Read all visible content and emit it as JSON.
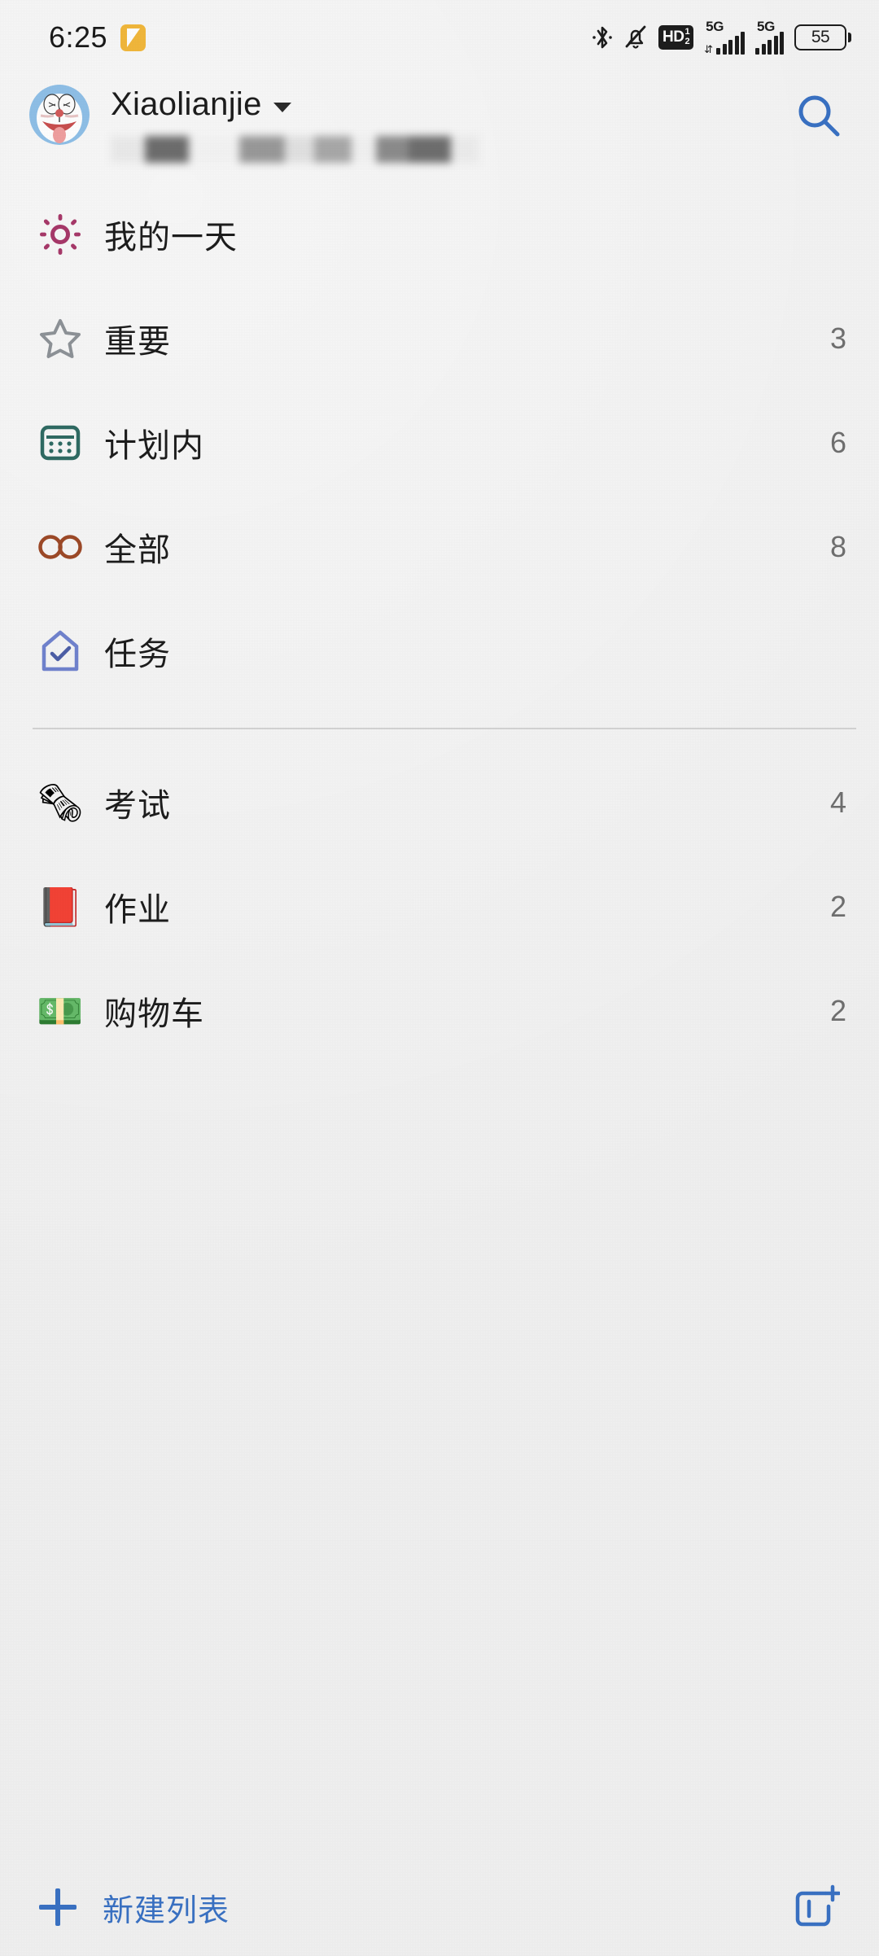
{
  "status_bar": {
    "time": "6:25",
    "note_icon": "note-icon",
    "icons": [
      "bluetooth-icon",
      "mute-bell-icon",
      "hd-voice-icon",
      "signal-5g-icon-1",
      "signal-5g-icon-2",
      "battery-icon"
    ],
    "hd_label": "HD",
    "hd_sup": "1",
    "hd_sub": "2",
    "network_1": "5G",
    "network_2": "5G",
    "battery_level": "55"
  },
  "account": {
    "avatar_alt": "doraemon-avatar",
    "name": "Xiaolianjie",
    "chevron": "chevron-down-icon",
    "email_redacted": true,
    "search_icon": "search-icon"
  },
  "lists": {
    "smart": [
      {
        "icon": "sun-icon",
        "label": "我的一天",
        "count": ""
      },
      {
        "icon": "star-icon",
        "label": "重要",
        "count": "3"
      },
      {
        "icon": "calendar-icon",
        "label": "计划内",
        "count": "6"
      },
      {
        "icon": "infinity-icon",
        "label": "全部",
        "count": "8"
      },
      {
        "icon": "house-check-icon",
        "label": "任务",
        "count": ""
      }
    ],
    "custom": [
      {
        "icon": "newspaper-emoji",
        "glyph": "🗞",
        "label": "考试",
        "count": "4"
      },
      {
        "icon": "closed-book-emoji",
        "glyph": "📕",
        "label": "作业",
        "count": "2"
      },
      {
        "icon": "banknote-emoji",
        "glyph": "💵",
        "label": "购物车",
        "count": "2"
      }
    ]
  },
  "bottom_bar": {
    "new_list_label": "新建列表",
    "plus_icon": "plus-icon",
    "new_group_icon": "new-group-icon"
  },
  "colors": {
    "accent_blue": "#3a72c4",
    "sun": "#a8396a",
    "star": "#8e9398",
    "calendar": "#2f6b63",
    "infinity": "#9e4a28",
    "house": "#7183cf",
    "background": "#f1f1f1",
    "text": "#1d1d1d",
    "count": "#707070"
  }
}
